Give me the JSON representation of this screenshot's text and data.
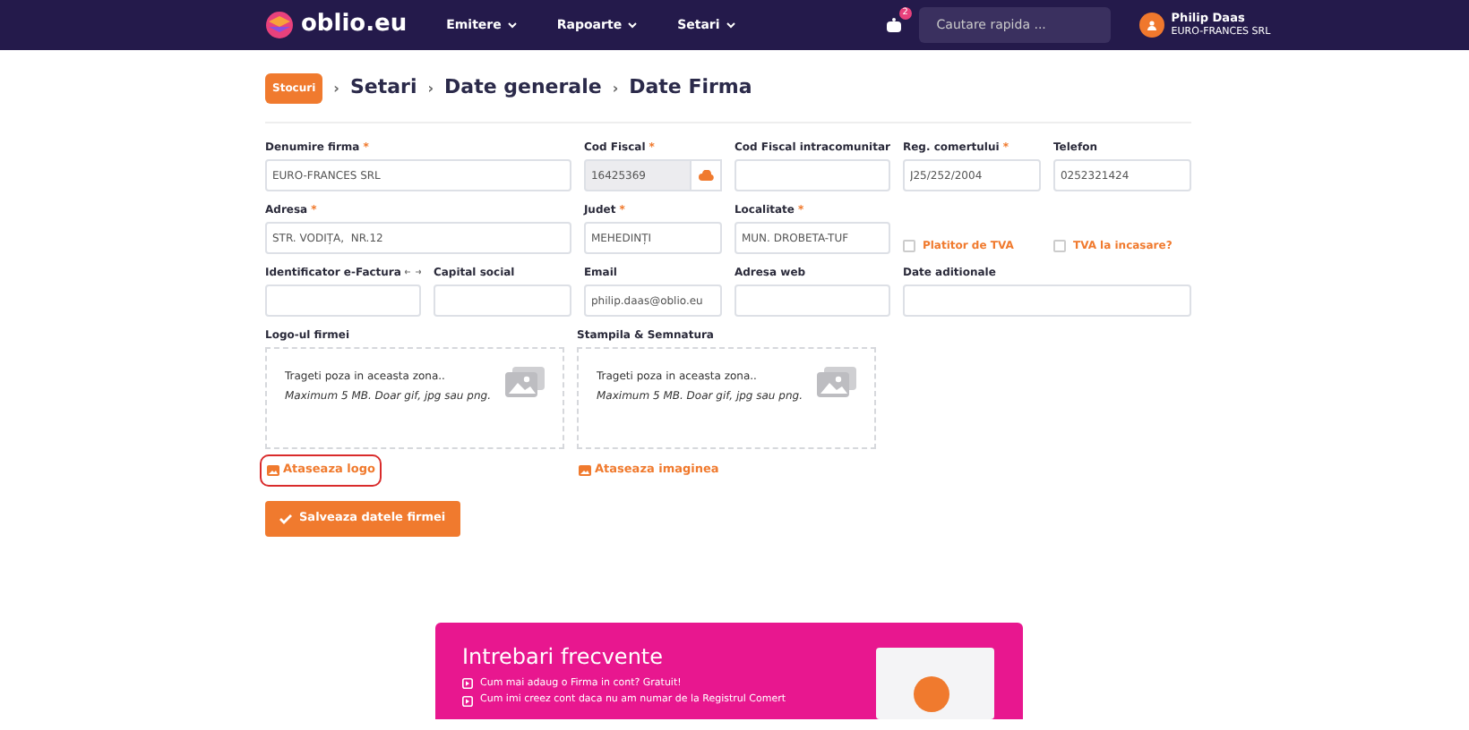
{
  "navbar": {
    "logo": "oblio.eu",
    "menus": [
      {
        "label": "Emitere"
      },
      {
        "label": "Rapoarte"
      },
      {
        "label": "Setari"
      }
    ],
    "notification_count": "2",
    "search": {
      "placeholder": "Cautare rapida ..."
    },
    "user": {
      "name": "Philip Daas",
      "company": "EURO-FRANCES SRL"
    }
  },
  "breadcrumb": {
    "badge": "Stocuri",
    "items": [
      {
        "separator": "›",
        "label": "Setari"
      },
      {
        "separator": "›",
        "label": "Date generale"
      },
      {
        "separator": "›",
        "label": "Date Firma"
      }
    ]
  },
  "fields": [
    {
      "kind": "input",
      "label": "Denumire firma",
      "required_mark": "*",
      "value": "EURO-FRANCES SRL"
    },
    {
      "kind": "cloud",
      "label": "Cod Fiscal",
      "required_mark": "*",
      "value": "16425369"
    },
    {
      "kind": "input",
      "label": "Cod Fiscal intracomunitar"
    },
    {
      "kind": "input",
      "label": "Reg. comertului",
      "required_mark": "*",
      "value": "J25/252/2004"
    },
    {
      "kind": "input",
      "label": "Telefon",
      "value": "0252321424"
    },
    {
      "kind": "input",
      "label": "Adresa",
      "required_mark": "*",
      "value": "STR. VODIȚA,  NR.12"
    },
    {
      "kind": "input",
      "label": "Judet",
      "required_mark": "*",
      "value": "MEHEDINȚI"
    },
    {
      "kind": "input",
      "label": "Localitate",
      "required_mark": "*",
      "value": "MUN. DROBETA-TUF"
    },
    {
      "kind": "checkbox",
      "label": "Platitor de TVA",
      "checked": false
    },
    {
      "kind": "checkbox",
      "label": "TVA la incasare?",
      "checked": false
    },
    {
      "kind": "input-info",
      "label": "Identificator e-Factura"
    },
    {
      "kind": "input",
      "label": "Capital social"
    },
    {
      "kind": "input",
      "label": "Email",
      "value": "philip.daas@oblio.eu"
    },
    {
      "kind": "input",
      "label": "Adresa web"
    },
    {
      "kind": "input",
      "label": "Date aditionale"
    }
  ],
  "uploads": [
    {
      "label": "Logo-ul firmei",
      "hint": "Trageti poza in aceasta zona..",
      "limits": "Maximum 5 MB. Doar gif, jpg sau png.",
      "link": "Ataseaza logo",
      "highlighted": true
    },
    {
      "label": "Stampila & Semnatura",
      "hint": "Trageti poza in aceasta zona..",
      "limits": "Maximum 5 MB. Doar gif, jpg sau png.",
      "link": "Ataseaza imaginea",
      "highlighted": false
    }
  ],
  "save_button": "Salveaza datele firmei",
  "faq": {
    "title": "Intrebari frecvente",
    "items": [
      "Cum mai adaug o Firma in cont? Gratuit!",
      "Cum imi creez cont daca nu am numar de la Registrul Comert"
    ]
  }
}
